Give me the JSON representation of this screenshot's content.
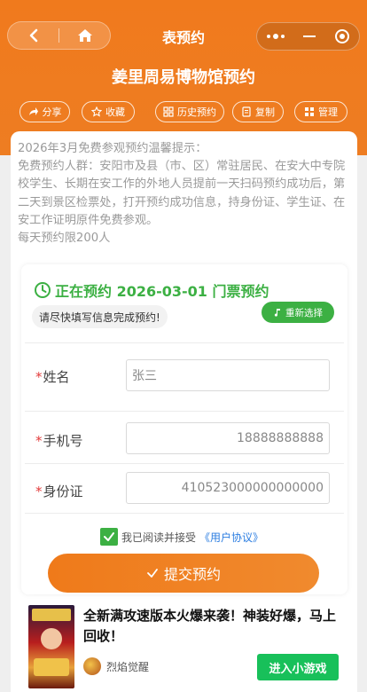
{
  "colors": {
    "brand": "#f07a1d",
    "success": "#3cb043",
    "link": "#2b7de1",
    "required": "#e23b3b"
  },
  "nav": {
    "title": "表预约",
    "back_icon": "chevron-left-icon",
    "home_icon": "home-icon",
    "more_icon": "more-dots-icon",
    "minimize_icon": "minimize-icon",
    "close_icon": "target-close-icon"
  },
  "header": {
    "title": "姜里周易博物馆预约",
    "actions": [
      {
        "label": "分享",
        "icon": "share-icon"
      },
      {
        "label": "收藏",
        "icon": "star-icon"
      },
      {
        "label": "历史预约",
        "icon": "history-icon"
      },
      {
        "label": "复制",
        "icon": "copy-icon"
      },
      {
        "label": "管理",
        "icon": "grid-icon"
      }
    ]
  },
  "notice": {
    "line1": "2026年3月免费参观预约温馨提示：",
    "line2": "免费预约人群：安阳市及县（市、区）常驻居民、在安大中专院校学生、长期在安工作的外地人员提前一天扫码预约成功后，第二天到景区检票处，打开预约成功信息，持身份证、学生证、在安工作证明原件免费参观。",
    "line3": "每天预约限200人"
  },
  "booking": {
    "status": "正在预约 2026-03-01 门票预约",
    "hint": "请尽快填写信息完成预约!",
    "reselect_label": "重新选择"
  },
  "form": {
    "name": {
      "label": "姓名",
      "value": "张三"
    },
    "phone": {
      "label": "手机号",
      "value": "18888888888"
    },
    "id_card": {
      "label": "身份证",
      "value": "410523000000000000"
    },
    "agree_prefix": "我已阅读并接受",
    "agree_link": "《用户协议》",
    "agree_checked": true,
    "submit_label": "提交预约"
  },
  "ad": {
    "title": "全新满攻速版本火爆来袭！神装好爆，马上回收！",
    "brand": "烈焰觉醒",
    "cta": "进入小游戏"
  }
}
